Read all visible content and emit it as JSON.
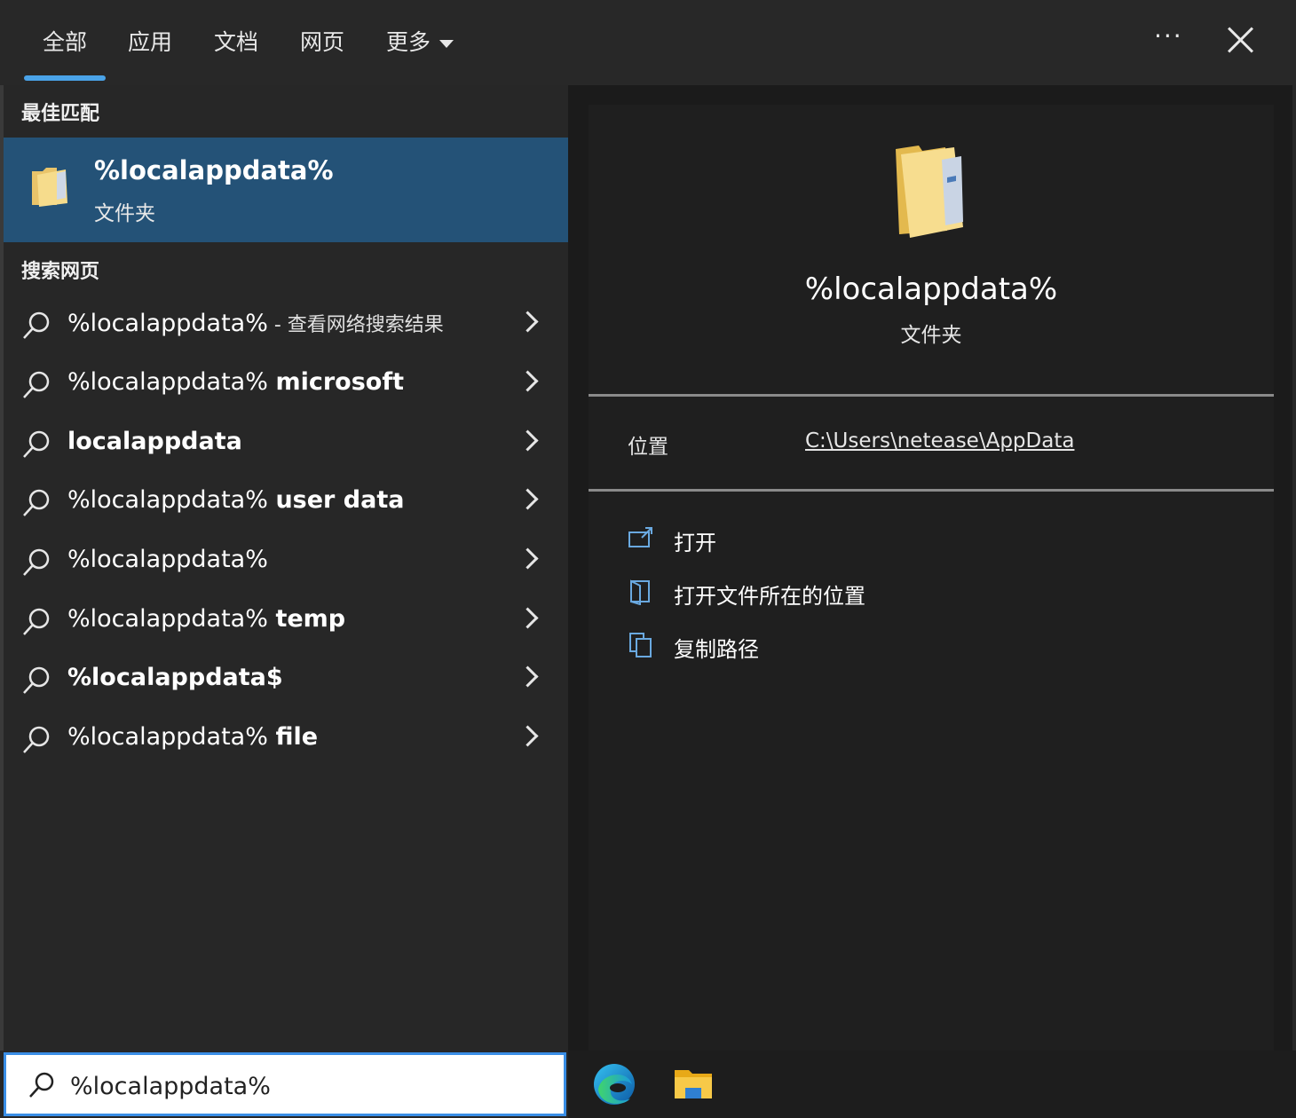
{
  "tabs": [
    {
      "label": "全部"
    },
    {
      "label": "应用"
    },
    {
      "label": "文档"
    },
    {
      "label": "网页"
    },
    {
      "label": "更多"
    }
  ],
  "more_dots": "···",
  "best_match": {
    "section_title": "最佳匹配",
    "name": "%localappdata%",
    "type": "文件夹"
  },
  "web_search": {
    "section_title": "搜索网页",
    "items": [
      {
        "normal": "%localappdata%",
        "bold": "",
        "suffix": " - 查看网络搜索结果"
      },
      {
        "normal": "%localappdata% ",
        "bold": "microsoft",
        "suffix": ""
      },
      {
        "normal": "",
        "bold": "localappdata",
        "suffix": ""
      },
      {
        "normal": "%localappdata% ",
        "bold": "user data",
        "suffix": ""
      },
      {
        "normal": "%localappdata%",
        "bold": "",
        "suffix": ""
      },
      {
        "normal": "%localappdata% ",
        "bold": "temp",
        "suffix": ""
      },
      {
        "normal": "",
        "bold": "%localappdata$",
        "suffix": ""
      },
      {
        "normal": "%localappdata% ",
        "bold": "file",
        "suffix": ""
      }
    ]
  },
  "preview": {
    "title": "%localappdata%",
    "type": "文件夹",
    "location_label": "位置",
    "location_path": "C:\\Users\\netease\\AppData",
    "actions": [
      {
        "label": "打开",
        "icon": "open-icon"
      },
      {
        "label": "打开文件所在的位置",
        "icon": "folder-location-icon"
      },
      {
        "label": "复制路径",
        "icon": "copy-icon"
      }
    ]
  },
  "search": {
    "value": "%localappdata%"
  },
  "taskbar": {
    "icons": [
      "edge-icon",
      "file-explorer-icon"
    ]
  },
  "colors": {
    "accent": "#4aa3e8",
    "best_match_bg": "#245277",
    "panel_bg": "#272727",
    "search_border": "#3a8ee6"
  }
}
